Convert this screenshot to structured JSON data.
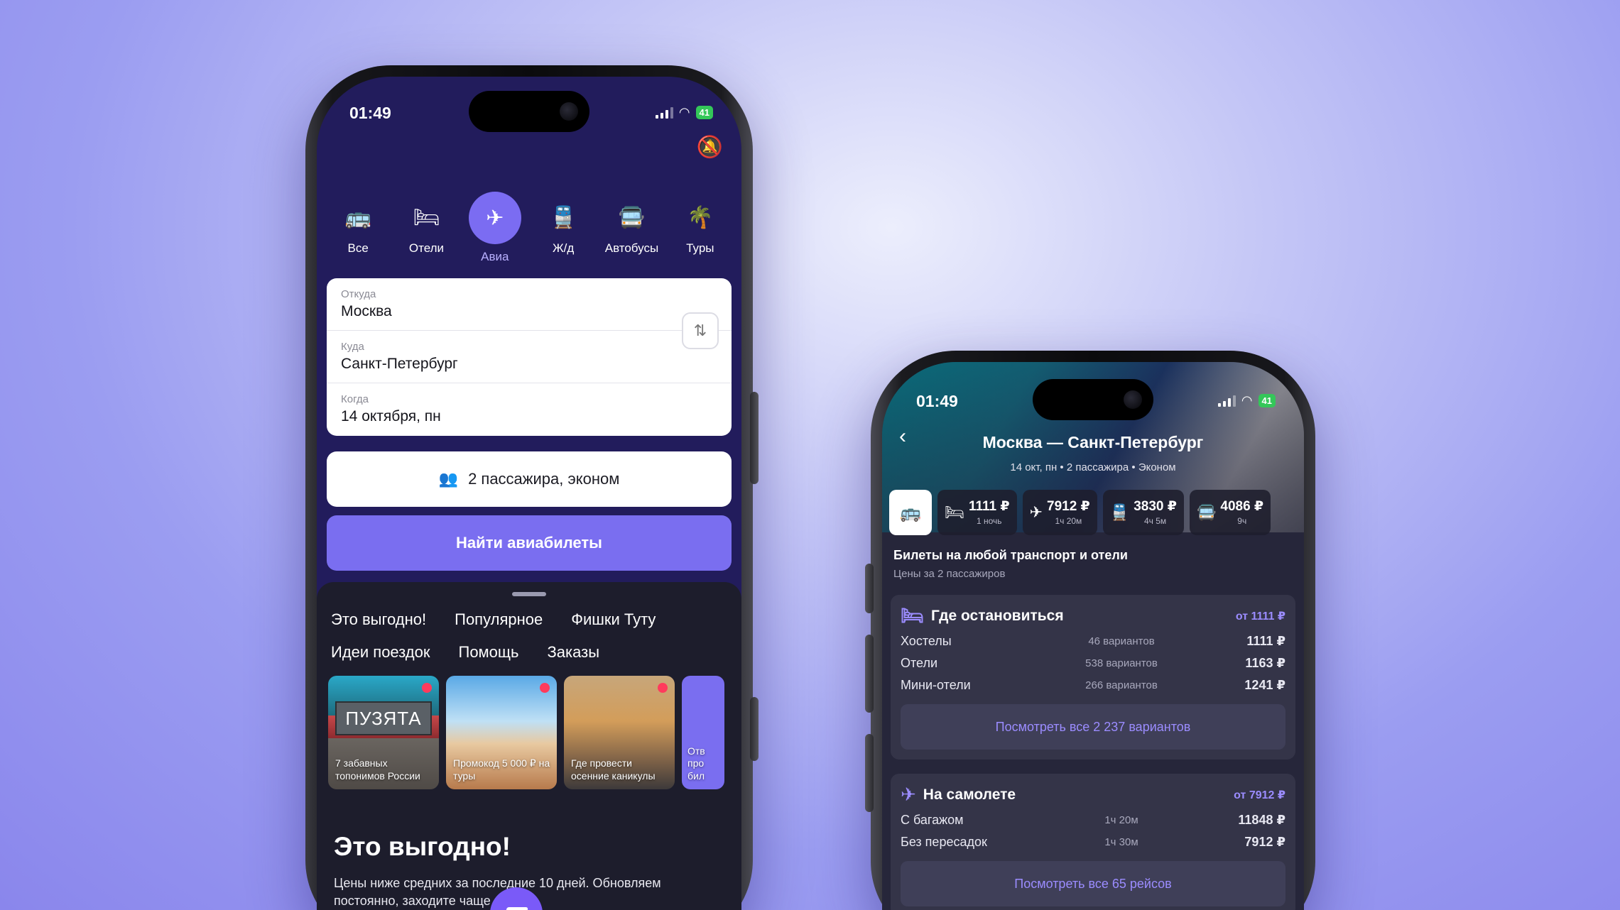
{
  "phone1": {
    "status": {
      "time": "01:49",
      "battery": "41"
    },
    "categories": [
      {
        "label": "Все",
        "icon": "all-transport-icon"
      },
      {
        "label": "Отели",
        "icon": "bed-icon"
      },
      {
        "label": "Авиа",
        "icon": "plane-icon",
        "active": true
      },
      {
        "label": "Ж/д",
        "icon": "train-icon"
      },
      {
        "label": "Автобусы",
        "icon": "bus-icon"
      },
      {
        "label": "Туры",
        "icon": "palm-icon"
      }
    ],
    "form": {
      "from_label": "Откуда",
      "from_value": "Москва",
      "to_label": "Куда",
      "to_value": "Санкт-Петербург",
      "when_label": "Когда",
      "when_value": "14 октября, пн"
    },
    "passengers": "2 пассажира, эконом",
    "find_button": "Найти авиабилеты",
    "chips": [
      "Это выгодно!",
      "Популярное",
      "Фишки Туту",
      "Идеи поездок",
      "Помощь",
      "Заказы"
    ],
    "stories": [
      {
        "sign": "ПУЗЯТА",
        "caption": "7 забавных топонимов России"
      },
      {
        "caption": "Промокод 5 000 ₽ на туры"
      },
      {
        "caption": "Где провести осенние каникулы"
      },
      {
        "caption": "Отв про бил"
      }
    ],
    "promo": {
      "title": "Это выгодно!",
      "text": "Цены ниже средних за последние 10 дней. Обновляем постоянно, заходите чаще"
    }
  },
  "phone2": {
    "status": {
      "time": "01:49",
      "battery": "41"
    },
    "route": "Москва — Санкт-Петербург",
    "route_sub": "14 окт, пн • 2 пассажира • Эконом",
    "modes": [
      {
        "icon": "hotel-icon",
        "price": "1111 ₽",
        "detail": "1 ночь"
      },
      {
        "icon": "plane-icon",
        "price": "7912 ₽",
        "detail": "1ч 20м"
      },
      {
        "icon": "train-icon",
        "price": "3830 ₽",
        "detail": "4ч 5м"
      },
      {
        "icon": "bus-icon",
        "price": "4086 ₽",
        "detail": "9ч"
      }
    ],
    "section_title": "Билеты на любой транспорт и отели",
    "section_sub": "Цены за 2 пассажиров",
    "stay_card": {
      "title": "Где остановиться",
      "from": "от 1111 ₽",
      "rows": [
        {
          "name": "Хостелы",
          "variants": "46 вариантов",
          "price": "1111 ₽"
        },
        {
          "name": "Отели",
          "variants": "538 вариантов",
          "price": "1163 ₽"
        },
        {
          "name": "Мини-отели",
          "variants": "266 вариантов",
          "price": "1241 ₽"
        }
      ],
      "all_button": "Посмотреть все 2 237 вариантов"
    },
    "plane_card": {
      "title": "На самолете",
      "from": "от 7912 ₽",
      "rows": [
        {
          "name": "С багажом",
          "duration": "1ч 20м",
          "price": "11848 ₽"
        },
        {
          "name": "Без пересадок",
          "duration": "1ч 30м",
          "price": "7912 ₽"
        }
      ],
      "all_button": "Посмотреть все 65 рейсов"
    }
  }
}
